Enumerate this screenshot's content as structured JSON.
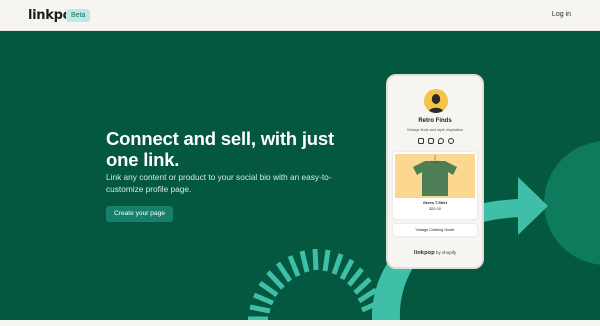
{
  "header": {
    "logo": "linkpop",
    "badge": "Beta",
    "login": "Log in"
  },
  "hero": {
    "headline": "Connect and sell, with just one link.",
    "subtext": "Link any content or product to your social bio with an easy-to-customize profile page.",
    "cta": "Create your page"
  },
  "phone": {
    "shop_name": "Retro Finds",
    "tagline": "Vintage finds and style inspiration",
    "socials": [
      "facebook-icon",
      "instagram-icon",
      "twitter-icon",
      "pinterest-icon"
    ],
    "product": {
      "name": "Green T-Shirt",
      "price": "$25.00"
    },
    "link_label": "Vintage Clothing Guide",
    "footer_logo": "linkpop",
    "footer_suffix": "by shopify"
  },
  "colors": {
    "hero_bg": "#03583f",
    "accent": "#3fbfa8",
    "badge_bg": "#bfe7e3",
    "cta_bg": "#16806a"
  }
}
